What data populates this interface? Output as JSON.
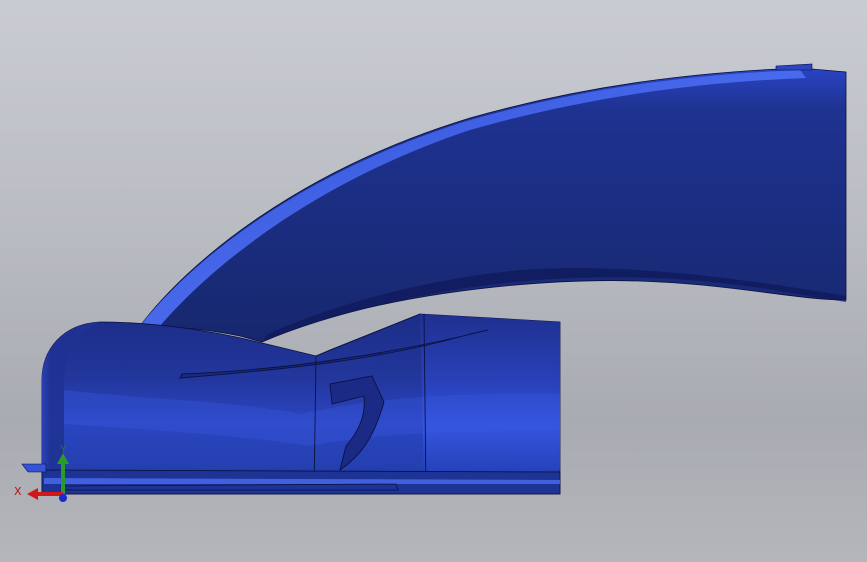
{
  "viewport": {
    "background_top": "#c9ccd2",
    "background_bottom": "#a8abb1"
  },
  "model": {
    "part_color": "#1d2f8c",
    "highlight_color": "#3f5ee6",
    "edge_color": "#0b1240"
  },
  "triad": {
    "x_label": "X",
    "y_label": "Y",
    "x_color": "#d01818",
    "y_color": "#2a9a2a",
    "z_color": "#1a2ad0"
  }
}
